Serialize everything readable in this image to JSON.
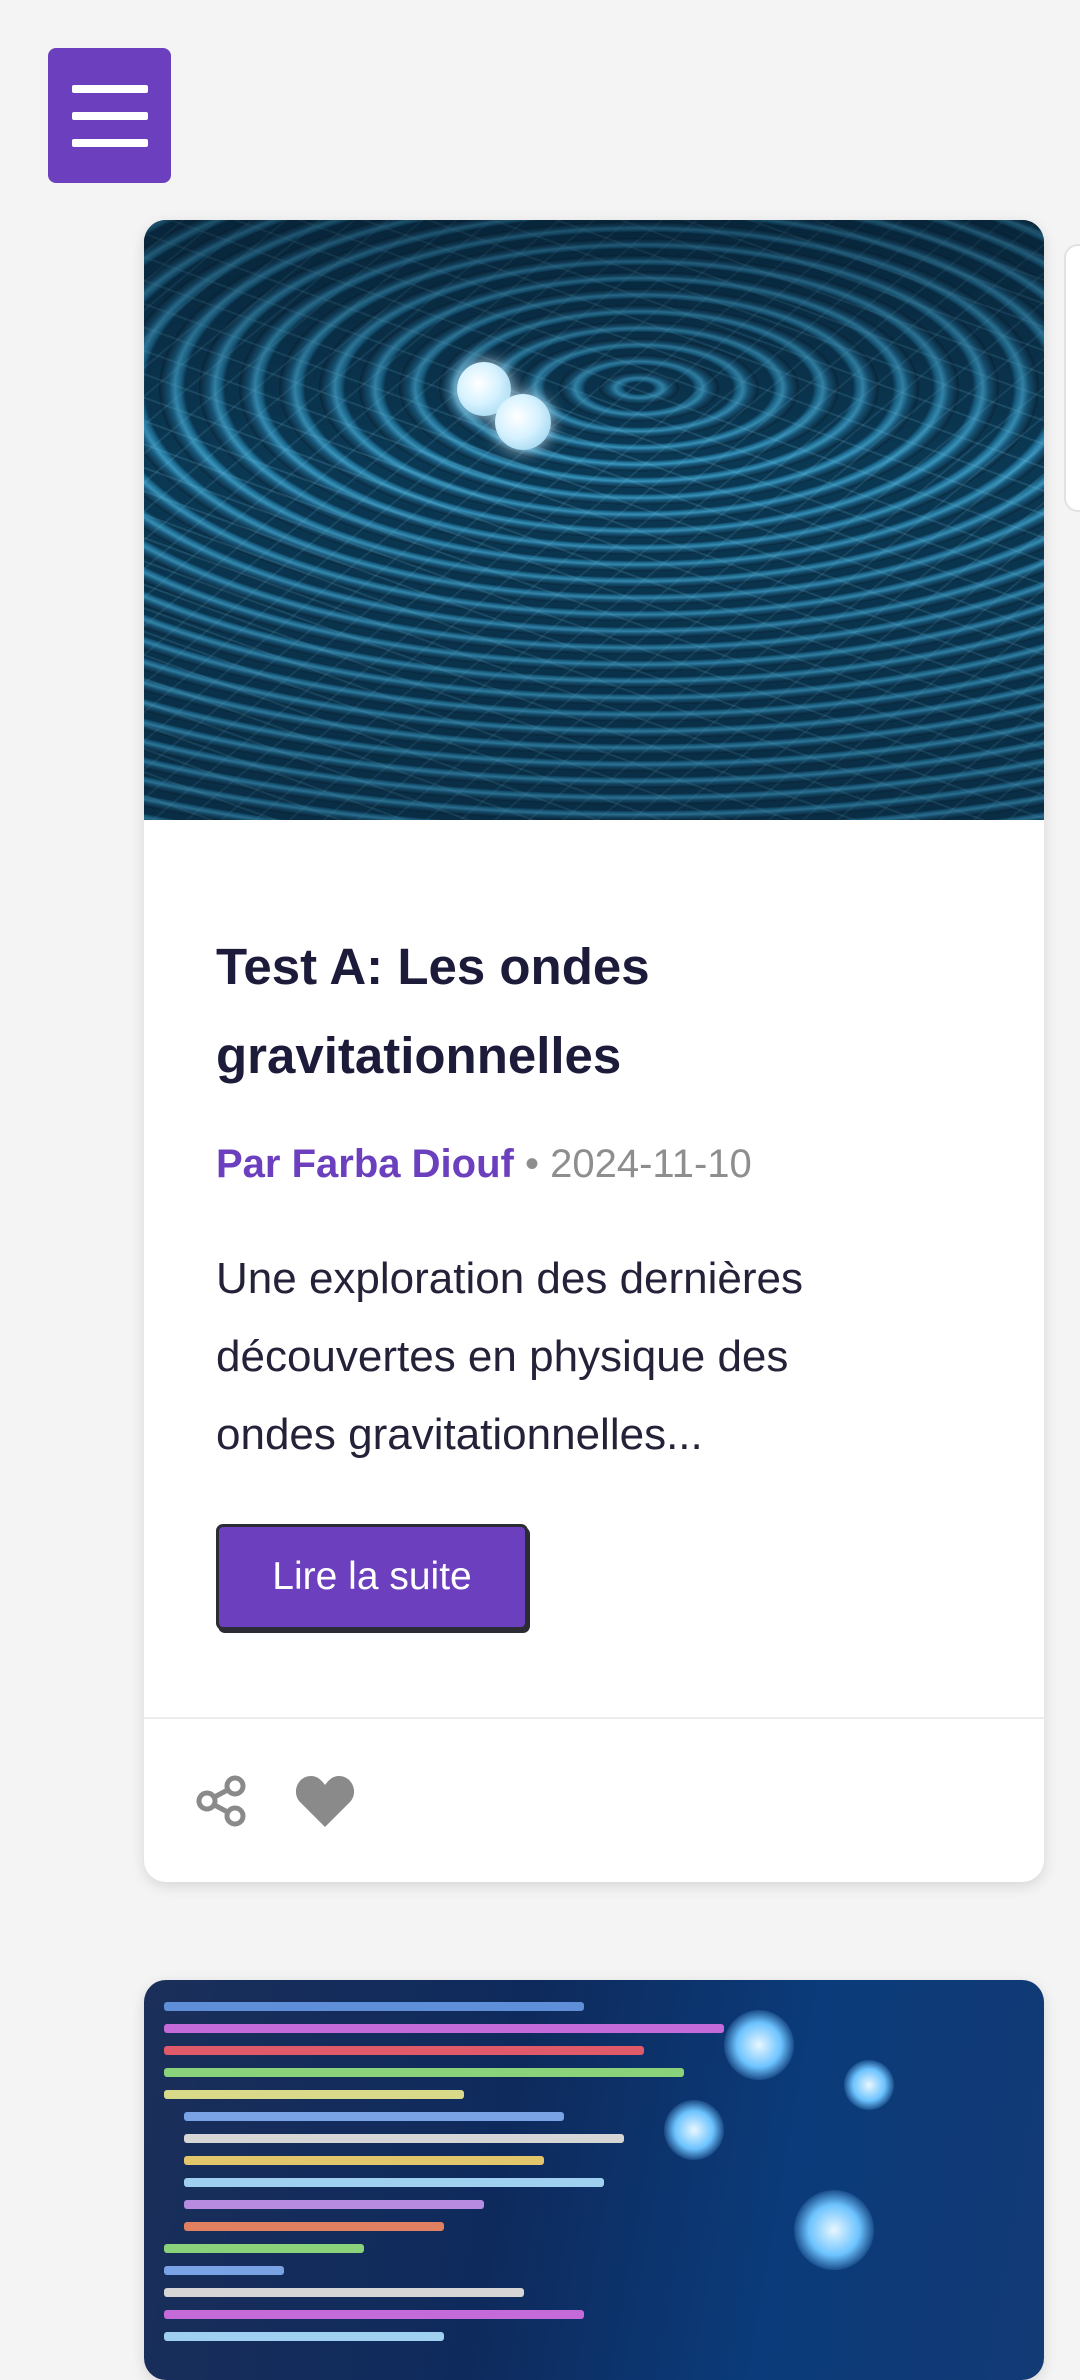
{
  "menu": {
    "icon": "hamburger-menu-icon"
  },
  "articles": [
    {
      "image_alt": "gravitational-waves-image",
      "title": "Test A: Les ondes gravitationnelles",
      "author": "Par Farba Diouf",
      "separator": "•",
      "date": "2024-11-10",
      "excerpt": "Une exploration des dernières découvertes en physique des ondes gravitationnelles...",
      "button_label": "Lire la suite",
      "actions": {
        "share_icon": "share-icon",
        "like_icon": "heart-icon"
      }
    },
    {
      "image_alt": "code-screen-image"
    }
  ],
  "colors": {
    "accent": "#6b3fbd",
    "title": "#1d1b3a",
    "muted": "#8e8e8e",
    "background": "#f4f4f4"
  }
}
